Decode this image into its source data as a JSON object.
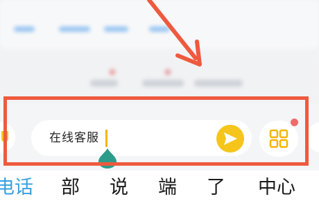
{
  "chat_input": {
    "value": "在线客服"
  },
  "candidates": [
    "电话",
    "部",
    "说",
    "端",
    "了",
    "中心"
  ],
  "colors": {
    "annotation": "#ee5a3e",
    "accent_yellow": "#f5c51b",
    "candidate_highlight": "#35a0e0",
    "notification_dot": "#ef6a6a"
  },
  "icons": {
    "send": "send-icon",
    "plugins": "grid-icon",
    "left": "voice-icon"
  }
}
